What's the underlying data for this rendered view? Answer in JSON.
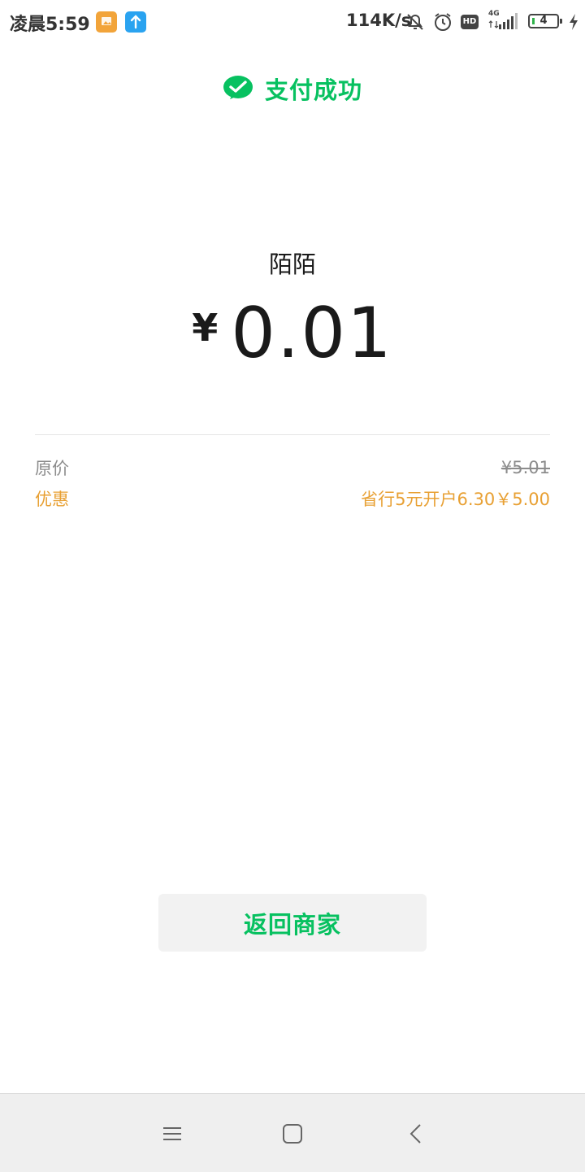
{
  "status_bar": {
    "time": "凌晨5:59",
    "net_speed": "114K/s",
    "hd_label": "HD",
    "network": "4G",
    "battery": "4",
    "app_icons": [
      "gallery-app-icon",
      "upload-app-icon"
    ]
  },
  "header": {
    "title": "支付成功",
    "icon": "wechat-pay-check-icon",
    "accent_color": "#07c160"
  },
  "payment": {
    "merchant": "陌陌",
    "currency": "¥",
    "amount": "0.01"
  },
  "details": {
    "original_label": "原价",
    "original_value": "¥5.01",
    "discount_label": "优惠",
    "discount_value": "省行5元开户6.30￥5.00",
    "discount_color": "#e8a033"
  },
  "actions": {
    "return_label": "返回商家"
  },
  "navbar": {
    "icons": [
      "menu-icon",
      "home-icon",
      "back-icon"
    ]
  }
}
